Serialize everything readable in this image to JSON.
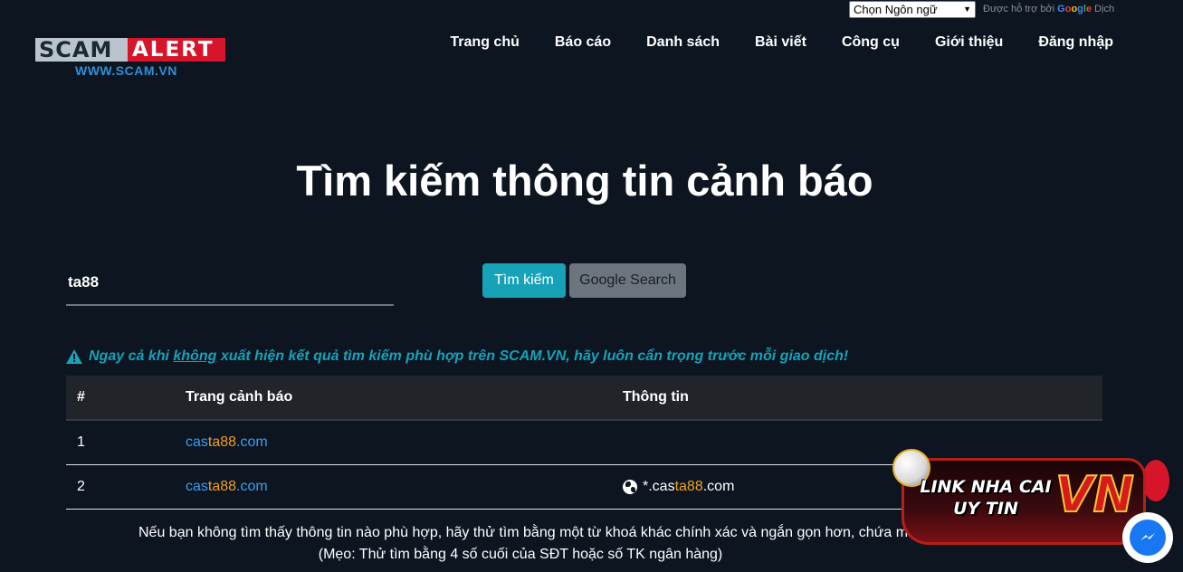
{
  "translate": {
    "select_label": "Chọn Ngôn ngữ",
    "powered_text": "Được hỗ trợ bởi",
    "google": "Google",
    "translate_word": "Dịch"
  },
  "logo": {
    "scam": "SCAM",
    "alert": "ALERT",
    "url": "WWW.SCAM.VN"
  },
  "nav": {
    "items": [
      {
        "label": "Trang chủ"
      },
      {
        "label": "Báo cáo"
      },
      {
        "label": "Danh sách"
      },
      {
        "label": "Bài viết"
      },
      {
        "label": "Công cụ"
      },
      {
        "label": "Giới thiệu"
      },
      {
        "label": "Đăng nhập"
      }
    ]
  },
  "page_title": "Tìm kiếm thông tin cảnh báo",
  "search": {
    "value": "ta88",
    "search_button": "Tìm kiếm",
    "google_button": "Google Search"
  },
  "warning": {
    "before": "Ngay cả khi ",
    "underlined": "không",
    "after": " xuất hiện kết quả tìm kiếm phù hợp trên SCAM.VN, hãy luôn cẩn trọng trước mỗi giao dịch!"
  },
  "table": {
    "headers": [
      "#",
      "Trang cảnh báo",
      "Thông tin"
    ],
    "rows": [
      {
        "num": "1",
        "link_pre": "cas",
        "link_mid": "ta88",
        "link_post": ".com",
        "info_pre": "",
        "info_mid": "",
        "info_post": ""
      },
      {
        "num": "2",
        "link_pre": "cas",
        "link_mid": "ta88",
        "link_post": ".com",
        "info_pre": "*.cas",
        "info_mid": "ta88",
        "info_post": ".com"
      }
    ]
  },
  "note": {
    "line1": "Nếu bạn không tìm thấy thông tin nào phù hợp, hãy thử tìm bằng một từ khoá khác chính xác và ngắn gọn hơn, chứa một từ",
    "line2": "(Mẹo: Thử tìm bằng 4 số cuối của SĐT hoặc số TK ngân hàng)"
  },
  "ad": {
    "line1": "LINK NHA CAI",
    "line2": "UY TIN",
    "vn": "VN"
  }
}
